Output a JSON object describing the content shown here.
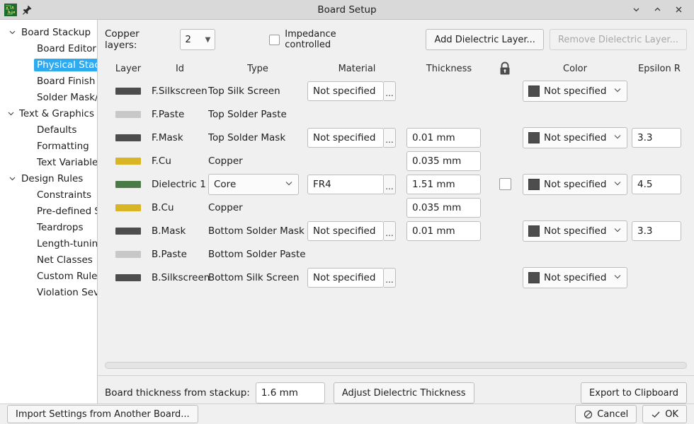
{
  "window": {
    "title": "Board Setup",
    "app_icon": "pcb-board-icon",
    "pin_icon": "pin-icon",
    "controls": [
      {
        "name": "minimize-button",
        "glyph": "⌄"
      },
      {
        "name": "maximize-button",
        "glyph": "⌃"
      },
      {
        "name": "close-button",
        "glyph": "✕"
      }
    ]
  },
  "sidebar": {
    "items": [
      {
        "label": "Board Stackup",
        "level": 0,
        "expanded": true,
        "selected": false
      },
      {
        "label": "Board Editor Layers",
        "level": 1,
        "expanded": false,
        "selected": false
      },
      {
        "label": "Physical Stackup",
        "level": 1,
        "expanded": false,
        "selected": true
      },
      {
        "label": "Board Finish",
        "level": 1,
        "expanded": false,
        "selected": false
      },
      {
        "label": "Solder Mask/Paste",
        "level": 1,
        "expanded": false,
        "selected": false
      },
      {
        "label": "Text & Graphics",
        "level": 0,
        "expanded": true,
        "selected": false
      },
      {
        "label": "Defaults",
        "level": 1,
        "expanded": false,
        "selected": false
      },
      {
        "label": "Formatting",
        "level": 1,
        "expanded": false,
        "selected": false
      },
      {
        "label": "Text Variables",
        "level": 1,
        "expanded": false,
        "selected": false
      },
      {
        "label": "Design Rules",
        "level": 0,
        "expanded": true,
        "selected": false
      },
      {
        "label": "Constraints",
        "level": 1,
        "expanded": false,
        "selected": false
      },
      {
        "label": "Pre-defined Sizes",
        "level": 1,
        "expanded": false,
        "selected": false
      },
      {
        "label": "Teardrops",
        "level": 1,
        "expanded": false,
        "selected": false
      },
      {
        "label": "Length-tuning Patterns",
        "level": 1,
        "expanded": false,
        "selected": false
      },
      {
        "label": "Net Classes",
        "level": 1,
        "expanded": false,
        "selected": false
      },
      {
        "label": "Custom Rules",
        "level": 1,
        "expanded": false,
        "selected": false
      },
      {
        "label": "Violation Severity",
        "level": 1,
        "expanded": false,
        "selected": false
      }
    ]
  },
  "toolbar": {
    "copper_layers_label": "Copper layers:",
    "copper_layers_value": "2",
    "impedance_label": "Impedance controlled",
    "impedance_checked": false,
    "add_dielectric_label": "Add Dielectric Layer...",
    "remove_dielectric_label": "Remove Dielectric Layer...",
    "remove_dielectric_enabled": false
  },
  "table": {
    "headers": {
      "layer": "Layer",
      "id": "Id",
      "type": "Type",
      "material": "Material",
      "thickness": "Thickness",
      "lock": "lock-icon",
      "color": "Color",
      "epsilon": "Epsilon R"
    },
    "rows": [
      {
        "id": "F.Silkscreen",
        "type": "Top Silk Screen",
        "type_is_combo": false,
        "swatch": "#4d4d4d",
        "material": "Not specified",
        "has_material": true,
        "thickness": "",
        "has_thickness": false,
        "has_lock": false,
        "lock_checked": false,
        "color": "Not specified",
        "color_swatch": "#4d4d4d",
        "has_color": true,
        "epsilon": "",
        "has_epsilon": false
      },
      {
        "id": "F.Paste",
        "type": "Top Solder Paste",
        "type_is_combo": false,
        "swatch": "#c8c8c8",
        "material": "",
        "has_material": false,
        "thickness": "",
        "has_thickness": false,
        "has_lock": false,
        "lock_checked": false,
        "color": "",
        "color_swatch": "",
        "has_color": false,
        "epsilon": "",
        "has_epsilon": false
      },
      {
        "id": "F.Mask",
        "type": "Top Solder Mask",
        "type_is_combo": false,
        "swatch": "#4d4d4d",
        "material": "Not specified",
        "has_material": true,
        "thickness": "0.01 mm",
        "has_thickness": true,
        "has_lock": false,
        "lock_checked": false,
        "color": "Not specified",
        "color_swatch": "#4d4d4d",
        "has_color": true,
        "epsilon": "3.3",
        "has_epsilon": true
      },
      {
        "id": "F.Cu",
        "type": "Copper",
        "type_is_combo": false,
        "swatch": "#d9b526",
        "material": "",
        "has_material": false,
        "thickness": "0.035 mm",
        "has_thickness": true,
        "has_lock": false,
        "lock_checked": false,
        "color": "",
        "color_swatch": "",
        "has_color": false,
        "epsilon": "",
        "has_epsilon": false
      },
      {
        "id": "Dielectric 1",
        "type": "Core",
        "type_is_combo": true,
        "swatch": "#4a7a46",
        "material": "FR4",
        "has_material": true,
        "thickness": "1.51 mm",
        "has_thickness": true,
        "has_lock": true,
        "lock_checked": false,
        "color": "Not specified",
        "color_swatch": "#4d4d4d",
        "has_color": true,
        "epsilon": "4.5",
        "has_epsilon": true
      },
      {
        "id": "B.Cu",
        "type": "Copper",
        "type_is_combo": false,
        "swatch": "#d9b526",
        "material": "",
        "has_material": false,
        "thickness": "0.035 mm",
        "has_thickness": true,
        "has_lock": false,
        "lock_checked": false,
        "color": "",
        "color_swatch": "",
        "has_color": false,
        "epsilon": "",
        "has_epsilon": false
      },
      {
        "id": "B.Mask",
        "type": "Bottom Solder Mask",
        "type_is_combo": false,
        "swatch": "#4d4d4d",
        "material": "Not specified",
        "has_material": true,
        "thickness": "0.01 mm",
        "has_thickness": true,
        "has_lock": false,
        "lock_checked": false,
        "color": "Not specified",
        "color_swatch": "#4d4d4d",
        "has_color": true,
        "epsilon": "3.3",
        "has_epsilon": true
      },
      {
        "id": "B.Paste",
        "type": "Bottom Solder Paste",
        "type_is_combo": false,
        "swatch": "#c8c8c8",
        "material": "",
        "has_material": false,
        "thickness": "",
        "has_thickness": false,
        "has_lock": false,
        "lock_checked": false,
        "color": "",
        "color_swatch": "",
        "has_color": false,
        "epsilon": "",
        "has_epsilon": false
      },
      {
        "id": "B.Silkscreen",
        "type": "Bottom Silk Screen",
        "type_is_combo": false,
        "swatch": "#4d4d4d",
        "material": "Not specified",
        "has_material": true,
        "thickness": "",
        "has_thickness": false,
        "has_lock": false,
        "lock_checked": false,
        "color": "Not specified",
        "color_swatch": "#4d4d4d",
        "has_color": true,
        "epsilon": "",
        "has_epsilon": false
      }
    ],
    "browse_glyph": "..."
  },
  "footer": {
    "board_thickness_label": "Board thickness from stackup:",
    "board_thickness_value": "1.6 mm",
    "adjust_label": "Adjust Dielectric Thickness",
    "export_label": "Export to Clipboard"
  },
  "bottom_bar": {
    "import_label": "Import Settings from Another Board...",
    "cancel_label": "Cancel",
    "cancel_icon": "no-entry-icon",
    "ok_label": "OK",
    "ok_icon": "check-icon"
  }
}
